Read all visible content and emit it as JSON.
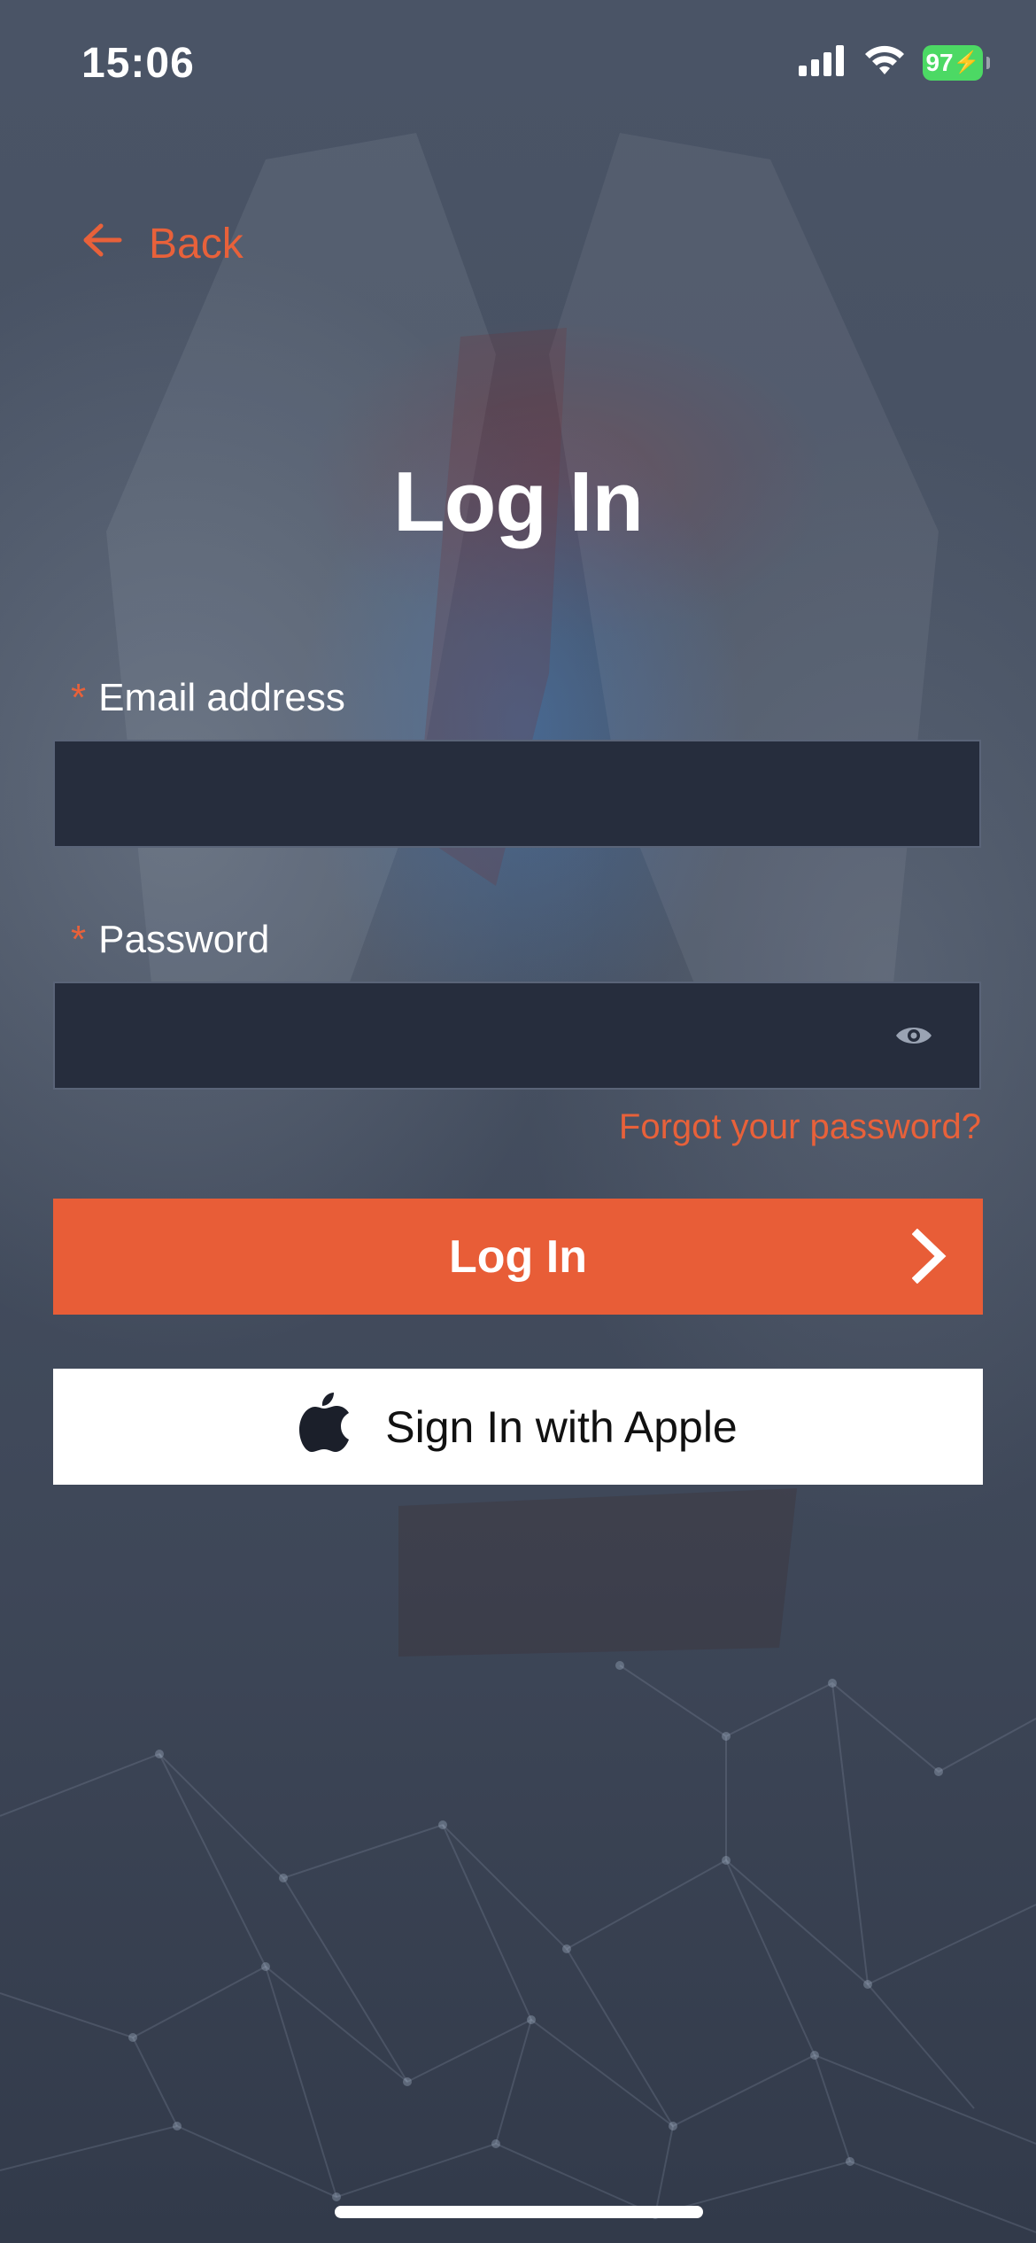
{
  "status_bar": {
    "time": "15:06",
    "battery": "97"
  },
  "nav": {
    "back_label": "Back"
  },
  "page": {
    "title": "Log In"
  },
  "form": {
    "email": {
      "label": "Email address",
      "required_marker": "*",
      "value": ""
    },
    "password": {
      "label": "Password",
      "required_marker": "*",
      "value": ""
    },
    "forgot_link": "Forgot your password?",
    "login_button": "Log In",
    "apple_button": "Sign In with Apple"
  },
  "icons": {
    "back": "arrow-left-icon",
    "signal": "cellular-signal-icon",
    "wifi": "wifi-icon",
    "battery": "battery-charging-icon",
    "eye": "eye-icon",
    "chevron": "chevron-right-icon",
    "apple": "apple-logo-icon"
  },
  "colors": {
    "accent": "#e85d37",
    "input_bg": "#262d3d",
    "battery_green": "#4cd964"
  }
}
